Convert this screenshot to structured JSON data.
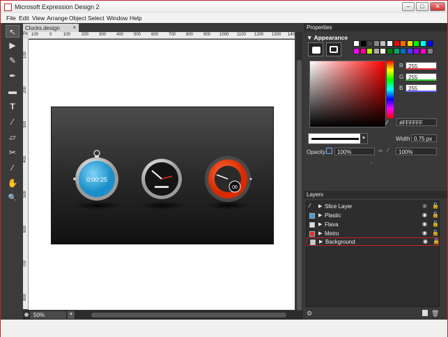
{
  "window": {
    "title": "Microsoft Expression Design 2",
    "controls": [
      "–",
      "□",
      "✕"
    ]
  },
  "menu": [
    "File",
    "Edit",
    "View",
    "Arrange",
    "Object",
    "Select",
    "Window",
    "Help"
  ],
  "document": {
    "tab_label": "Clocks.design",
    "close": "×",
    "zoom": "50%"
  },
  "rulers": {
    "corner": "Px",
    "h": [
      "100",
      "0",
      "100",
      "200",
      "300",
      "400",
      "500",
      "600",
      "700",
      "800",
      "900",
      "1000",
      "1100",
      "1200",
      "1300",
      "140"
    ],
    "v": [
      "100",
      "200",
      "300",
      "400",
      "500",
      "600",
      "700",
      "800"
    ]
  },
  "clocks": {
    "digital_time": "0:00:25",
    "date_badge": "06"
  },
  "tools": [
    {
      "name": "selection-tool",
      "glyph": "↖"
    },
    {
      "name": "direct-selection-tool",
      "glyph": "▶"
    },
    {
      "name": "paintbrush-tool",
      "glyph": "✎"
    },
    {
      "name": "pen-tool",
      "glyph": "✒"
    },
    {
      "name": "rectangle-tool",
      "glyph": "▬"
    },
    {
      "name": "text-tool",
      "glyph": "T"
    },
    {
      "name": "eyedropper-tool",
      "glyph": "⁄"
    },
    {
      "name": "eraser-tool",
      "glyph": "▱"
    },
    {
      "name": "scissors-tool",
      "glyph": "✂"
    },
    {
      "name": "transform-tool",
      "glyph": "⁄"
    },
    {
      "name": "pan-tool",
      "glyph": "✋"
    },
    {
      "name": "zoom-tool",
      "glyph": "🔍"
    }
  ],
  "properties": {
    "title": "Properties",
    "section": "Appearance",
    "rgb": [
      {
        "label": "R",
        "value": "255"
      },
      {
        "label": "G",
        "value": "255"
      },
      {
        "label": "B",
        "value": "255"
      }
    ],
    "hex": "#FFFFFF",
    "width_label": "Width",
    "width_value": "0.75 px",
    "opacity_label": "Opacity",
    "opacity_value": "100%",
    "second_value": "100%",
    "swatches": [
      "#ffffff",
      "#000000",
      "#444444",
      "#888888",
      "#c0c0c0",
      "#ffffff",
      "#ff0000",
      "#ff6a00",
      "#ffd800",
      "#00ff00",
      "#00ffff",
      "#0000ff",
      "#ff00ff",
      "#ff0090",
      "#b6ff00",
      "#aaaaaa",
      "#ffffff",
      "#008000",
      "#00a86b",
      "#0070c0",
      "#4040ff",
      "#a000ff",
      "#ff00c0",
      "#808080"
    ]
  },
  "layers": {
    "title": "Layers",
    "items": [
      {
        "name": "Slice Layer",
        "color": "#ffffff"
      },
      {
        "name": "Plastic",
        "color": "#3aa0e0"
      },
      {
        "name": "Flava",
        "color": "#e0e0e0"
      },
      {
        "name": "Metro",
        "color": "#e03030"
      },
      {
        "name": "Background",
        "color": "#cccccc"
      }
    ]
  }
}
